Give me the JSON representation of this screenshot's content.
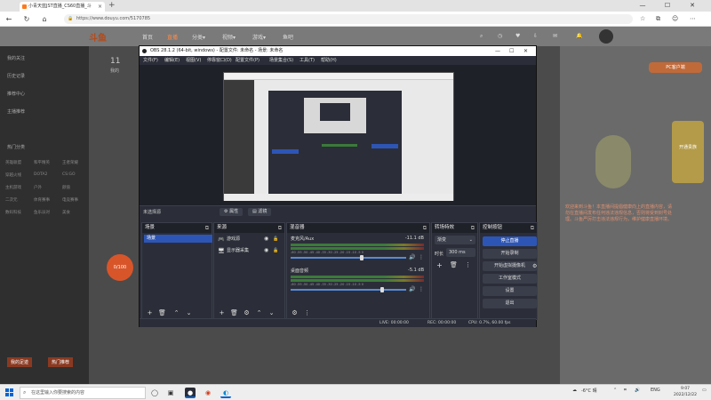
{
  "browser": {
    "tab_title": "小青天蓝JST直播_CS60直播_斗",
    "url": "https://www.douyu.com/5170785",
    "new_tab": "+",
    "minimize": "—",
    "maximize": "☐",
    "close": "✕"
  },
  "site": {
    "logo": "斗鱼",
    "nav": [
      "首页",
      "直播",
      "分类▾",
      "视频▾",
      "游戏▾",
      "鱼吧"
    ],
    "sidebar_items": [
      "我的关注",
      "历史记录",
      "推荐中心",
      "主播推荐",
      "热门分类"
    ],
    "sidebar_grid": [
      "英雄联盟",
      "和平精英",
      "王者荣耀",
      "穿越火线",
      "DOTA2",
      "CS:GO",
      "主机游戏",
      "户外",
      "颜值",
      "二次元",
      "体育赛事",
      "电竞赛事",
      "数码科技",
      "鱼乐派对",
      "美食"
    ],
    "sidebar_bottom": [
      "我的足迹",
      "热门推荐"
    ],
    "badge_text": "0/100",
    "right_text": "欢迎来到斗鱼！本直播间提倡健康向上的直播内容，请勿在直播间发布任何违法违规信息，否则将受到封号处理。斗鱼严厉打击违法违规行为，维护健康直播环境。",
    "right_top_btn": "PC客户端",
    "right_sticker": "开通贵族",
    "page_number": "11",
    "day_label": "我的"
  },
  "obs": {
    "title": "OBS 28.1.2 (64-bit, windows) - 配置文件: 未命名 - 场景: 未命名",
    "menu": [
      "文件(F)",
      "编辑(E)",
      "视图(V)",
      "停靠窗口(D)",
      "配置文件(P)",
      "场景集合(S)",
      "工具(T)",
      "帮助(H)"
    ],
    "source_bar": {
      "label": "未选择源",
      "properties": "⚙ 属性",
      "filters": "▤ 滤镜"
    },
    "scenes": {
      "title": "场景",
      "items": [
        "场景"
      ]
    },
    "sources": {
      "title": "来源",
      "items": [
        {
          "icon": "🎮",
          "label": "游戏源"
        },
        {
          "icon": "🖥",
          "label": "显示器采集"
        }
      ]
    },
    "mixer": {
      "title": "混音器",
      "channels": [
        {
          "name": "麦克风/Aux",
          "db": "-11.1 dB",
          "level": 0.62
        },
        {
          "name": "桌面音频",
          "db": "-5.1 dB",
          "level": 0.8
        }
      ],
      "ticks": "-60 -55 -50 -45 -40 -35 -30 -25 -20 -15 -10 -5 0"
    },
    "transitions": {
      "title": "转场特效",
      "selected": "渐变",
      "duration_label": "时长",
      "duration": "300 ms"
    },
    "controls": {
      "title": "控制按钮",
      "buttons": [
        "停止直播",
        "开始录制",
        "开始虚拟摄像机",
        "工作室模式",
        "设置",
        "退出"
      ]
    },
    "status": {
      "live": "LIVE: 00:00:00",
      "rec": "REC: 00:00:00",
      "cpu": "CPU: 0.7%, 60.00 fps"
    }
  },
  "taskbar": {
    "search_placeholder": "在这里输入你要搜索的内容",
    "weather": "-6°C 晴",
    "lang": "ENG",
    "time": "9:07",
    "date": "2022/12/22"
  }
}
